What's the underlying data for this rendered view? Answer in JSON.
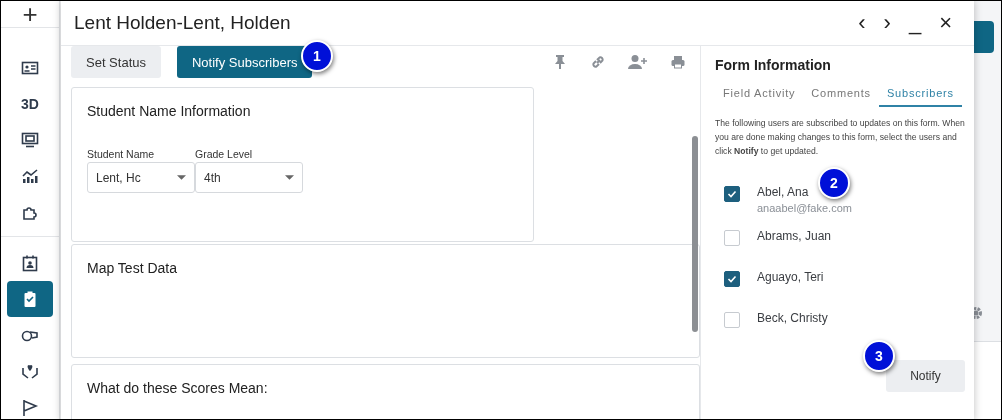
{
  "sidebar": {
    "add_label": "+",
    "items": [
      {
        "selected": false
      },
      {
        "label": "3D",
        "selected": false
      },
      {
        "selected": false
      },
      {
        "selected": false
      },
      {
        "selected": false
      },
      {
        "selected": false
      },
      {
        "selected": true
      },
      {
        "selected": false
      },
      {
        "selected": false
      },
      {
        "selected": false
      }
    ]
  },
  "window": {
    "title": "Lent Holden-Lent, Holden",
    "nav": [
      "‹",
      "›"
    ],
    "minimize": "_",
    "close": "×"
  },
  "toolbar": {
    "buttons": [
      {
        "label": "Set Status",
        "kind": "secondary"
      },
      {
        "label": "Notify Subscribers",
        "kind": "primary"
      }
    ]
  },
  "sections": [
    {
      "title": "Student Name Information",
      "fields": [
        {
          "label": "Student Name",
          "value": "Lent, Hc"
        },
        {
          "label": "Grade Level",
          "value": "4th"
        }
      ]
    },
    {
      "title": "Map Test Data"
    },
    {
      "title": "What do these Scores Mean:"
    }
  ],
  "form_information": {
    "title": "Form Information",
    "tabs": [
      {
        "label": "Field Activity",
        "selected": false
      },
      {
        "label": "Comments",
        "selected": false
      },
      {
        "label": "Subscribers",
        "selected": true
      }
    ],
    "description": "The following users are subscribed to updates on this form. When you are done making changes to this form, select the users and click **Notify** to get updated.",
    "subscribers": [
      {
        "name": "Abel, Ana",
        "email": "anaabel@fake.com",
        "checked": true
      },
      {
        "name": "Abrams, Juan",
        "checked": false
      },
      {
        "name": "Aguayo, Teri",
        "checked": true
      },
      {
        "name": "Beck, Christy",
        "checked": false
      }
    ],
    "notify_button": "Notify"
  },
  "callouts": [
    "1",
    "2",
    "3"
  ]
}
